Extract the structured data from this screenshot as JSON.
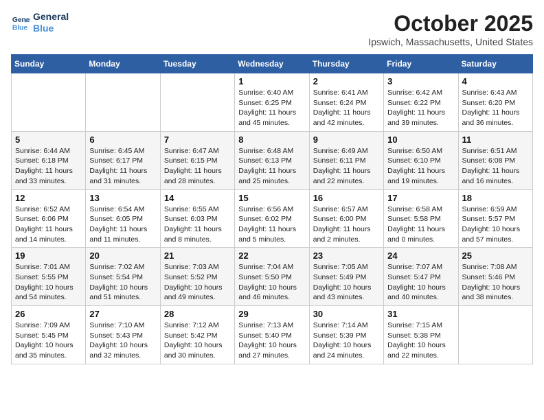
{
  "header": {
    "logo_line1": "General",
    "logo_line2": "Blue",
    "month": "October 2025",
    "location": "Ipswich, Massachusetts, United States"
  },
  "weekdays": [
    "Sunday",
    "Monday",
    "Tuesday",
    "Wednesday",
    "Thursday",
    "Friday",
    "Saturday"
  ],
  "weeks": [
    [
      {
        "day": "",
        "info": ""
      },
      {
        "day": "",
        "info": ""
      },
      {
        "day": "",
        "info": ""
      },
      {
        "day": "1",
        "info": "Sunrise: 6:40 AM\nSunset: 6:25 PM\nDaylight: 11 hours\nand 45 minutes."
      },
      {
        "day": "2",
        "info": "Sunrise: 6:41 AM\nSunset: 6:24 PM\nDaylight: 11 hours\nand 42 minutes."
      },
      {
        "day": "3",
        "info": "Sunrise: 6:42 AM\nSunset: 6:22 PM\nDaylight: 11 hours\nand 39 minutes."
      },
      {
        "day": "4",
        "info": "Sunrise: 6:43 AM\nSunset: 6:20 PM\nDaylight: 11 hours\nand 36 minutes."
      }
    ],
    [
      {
        "day": "5",
        "info": "Sunrise: 6:44 AM\nSunset: 6:18 PM\nDaylight: 11 hours\nand 33 minutes."
      },
      {
        "day": "6",
        "info": "Sunrise: 6:45 AM\nSunset: 6:17 PM\nDaylight: 11 hours\nand 31 minutes."
      },
      {
        "day": "7",
        "info": "Sunrise: 6:47 AM\nSunset: 6:15 PM\nDaylight: 11 hours\nand 28 minutes."
      },
      {
        "day": "8",
        "info": "Sunrise: 6:48 AM\nSunset: 6:13 PM\nDaylight: 11 hours\nand 25 minutes."
      },
      {
        "day": "9",
        "info": "Sunrise: 6:49 AM\nSunset: 6:11 PM\nDaylight: 11 hours\nand 22 minutes."
      },
      {
        "day": "10",
        "info": "Sunrise: 6:50 AM\nSunset: 6:10 PM\nDaylight: 11 hours\nand 19 minutes."
      },
      {
        "day": "11",
        "info": "Sunrise: 6:51 AM\nSunset: 6:08 PM\nDaylight: 11 hours\nand 16 minutes."
      }
    ],
    [
      {
        "day": "12",
        "info": "Sunrise: 6:52 AM\nSunset: 6:06 PM\nDaylight: 11 hours\nand 14 minutes."
      },
      {
        "day": "13",
        "info": "Sunrise: 6:54 AM\nSunset: 6:05 PM\nDaylight: 11 hours\nand 11 minutes."
      },
      {
        "day": "14",
        "info": "Sunrise: 6:55 AM\nSunset: 6:03 PM\nDaylight: 11 hours\nand 8 minutes."
      },
      {
        "day": "15",
        "info": "Sunrise: 6:56 AM\nSunset: 6:02 PM\nDaylight: 11 hours\nand 5 minutes."
      },
      {
        "day": "16",
        "info": "Sunrise: 6:57 AM\nSunset: 6:00 PM\nDaylight: 11 hours\nand 2 minutes."
      },
      {
        "day": "17",
        "info": "Sunrise: 6:58 AM\nSunset: 5:58 PM\nDaylight: 11 hours\nand 0 minutes."
      },
      {
        "day": "18",
        "info": "Sunrise: 6:59 AM\nSunset: 5:57 PM\nDaylight: 10 hours\nand 57 minutes."
      }
    ],
    [
      {
        "day": "19",
        "info": "Sunrise: 7:01 AM\nSunset: 5:55 PM\nDaylight: 10 hours\nand 54 minutes."
      },
      {
        "day": "20",
        "info": "Sunrise: 7:02 AM\nSunset: 5:54 PM\nDaylight: 10 hours\nand 51 minutes."
      },
      {
        "day": "21",
        "info": "Sunrise: 7:03 AM\nSunset: 5:52 PM\nDaylight: 10 hours\nand 49 minutes."
      },
      {
        "day": "22",
        "info": "Sunrise: 7:04 AM\nSunset: 5:50 PM\nDaylight: 10 hours\nand 46 minutes."
      },
      {
        "day": "23",
        "info": "Sunrise: 7:05 AM\nSunset: 5:49 PM\nDaylight: 10 hours\nand 43 minutes."
      },
      {
        "day": "24",
        "info": "Sunrise: 7:07 AM\nSunset: 5:47 PM\nDaylight: 10 hours\nand 40 minutes."
      },
      {
        "day": "25",
        "info": "Sunrise: 7:08 AM\nSunset: 5:46 PM\nDaylight: 10 hours\nand 38 minutes."
      }
    ],
    [
      {
        "day": "26",
        "info": "Sunrise: 7:09 AM\nSunset: 5:45 PM\nDaylight: 10 hours\nand 35 minutes."
      },
      {
        "day": "27",
        "info": "Sunrise: 7:10 AM\nSunset: 5:43 PM\nDaylight: 10 hours\nand 32 minutes."
      },
      {
        "day": "28",
        "info": "Sunrise: 7:12 AM\nSunset: 5:42 PM\nDaylight: 10 hours\nand 30 minutes."
      },
      {
        "day": "29",
        "info": "Sunrise: 7:13 AM\nSunset: 5:40 PM\nDaylight: 10 hours\nand 27 minutes."
      },
      {
        "day": "30",
        "info": "Sunrise: 7:14 AM\nSunset: 5:39 PM\nDaylight: 10 hours\nand 24 minutes."
      },
      {
        "day": "31",
        "info": "Sunrise: 7:15 AM\nSunset: 5:38 PM\nDaylight: 10 hours\nand 22 minutes."
      },
      {
        "day": "",
        "info": ""
      }
    ]
  ]
}
